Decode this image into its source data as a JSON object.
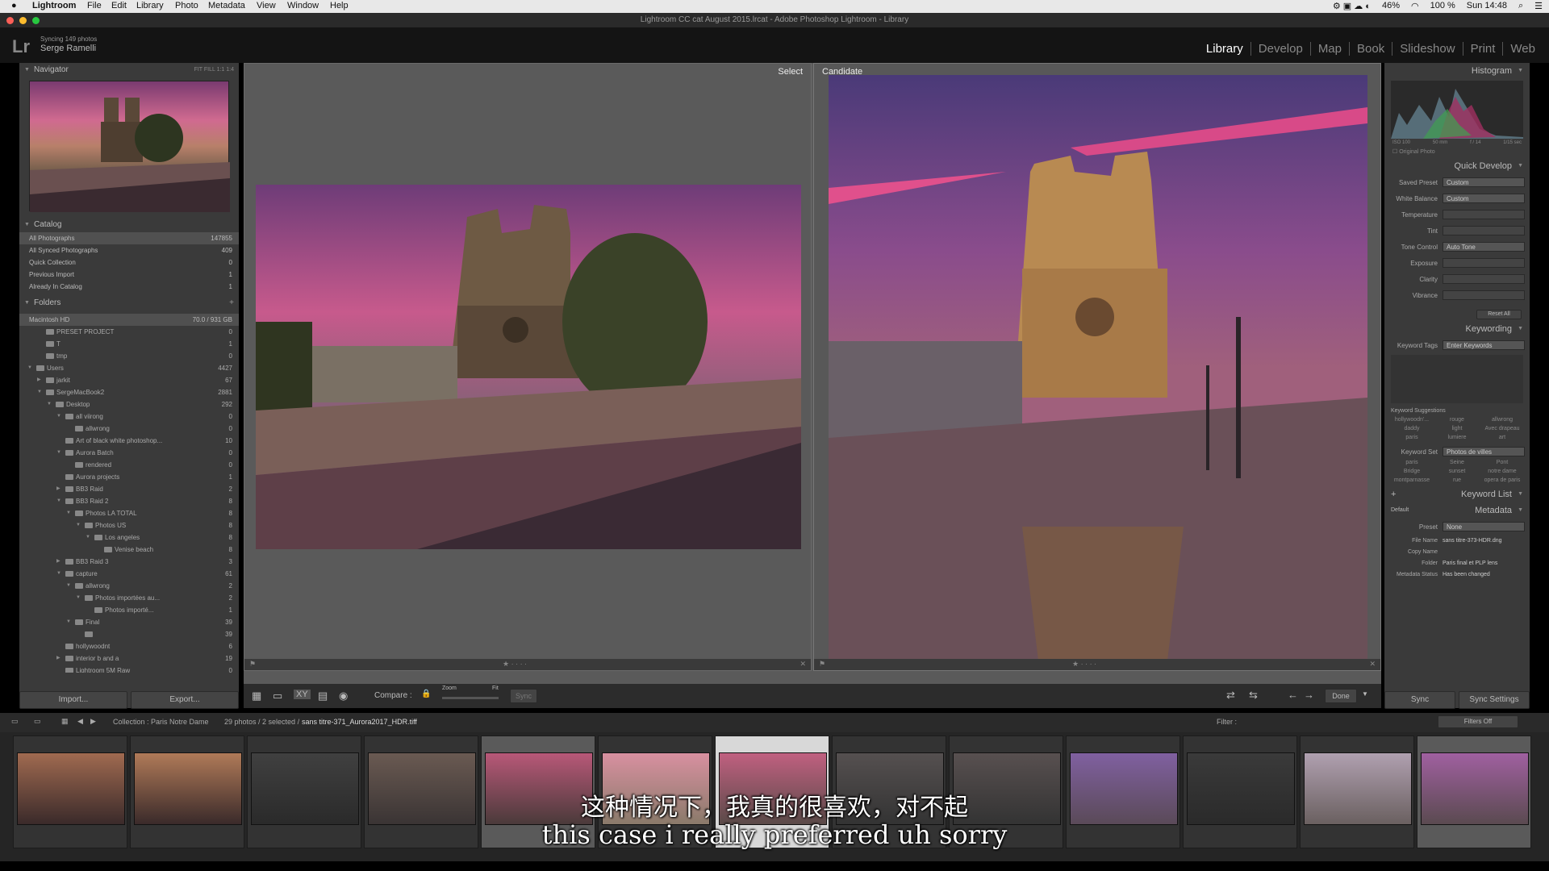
{
  "menubar": {
    "items": [
      "Lightroom",
      "File",
      "Edit",
      "Library",
      "Photo",
      "Metadata",
      "View",
      "Window",
      "Help"
    ],
    "battery": "46%",
    "zoom": "100 %",
    "clock": "Sun 14:48"
  },
  "window": {
    "title": "Lightroom CC cat August 2015.lrcat - Adobe Photoshop Lightroom - Library"
  },
  "identity": {
    "logo": "Lr",
    "sync": "Syncing 149 photos",
    "user": "Serge Ramelli"
  },
  "modules": [
    "Library",
    "Develop",
    "Map",
    "Book",
    "Slideshow",
    "Print",
    "Web"
  ],
  "left": {
    "navigator": {
      "title": "Navigator",
      "opts": "FIT FILL 1:1 1:4"
    },
    "catalog": {
      "title": "Catalog",
      "rows": [
        {
          "label": "All Photographs",
          "count": "147855"
        },
        {
          "label": "All Synced Photographs",
          "count": "409"
        },
        {
          "label": "Quick Collection",
          "count": "0"
        },
        {
          "label": "Previous Import",
          "count": "1"
        },
        {
          "label": "Already In Catalog",
          "count": "1"
        }
      ]
    },
    "folders": {
      "title": "Folders",
      "volume": "Macintosh HD",
      "volume_size": "70.0 / 931 GB",
      "rows": [
        {
          "label": "PRESET PROJECT",
          "count": "0",
          "d": 1,
          "t": ""
        },
        {
          "label": "T",
          "count": "1",
          "d": 1,
          "t": ""
        },
        {
          "label": "tmp",
          "count": "0",
          "d": 1,
          "t": ""
        },
        {
          "label": "Users",
          "count": "4427",
          "d": 0,
          "t": "▼"
        },
        {
          "label": "jarkit",
          "count": "67",
          "d": 1,
          "t": "▶"
        },
        {
          "label": "SergeMacBook2",
          "count": "2881",
          "d": 1,
          "t": "▼"
        },
        {
          "label": "Desktop",
          "count": "292",
          "d": 2,
          "t": "▼"
        },
        {
          "label": "all viirong",
          "count": "0",
          "d": 3,
          "t": "▼"
        },
        {
          "label": "allwrong",
          "count": "0",
          "d": 4,
          "t": ""
        },
        {
          "label": "Art of black white photoshop...",
          "count": "10",
          "d": 3,
          "t": ""
        },
        {
          "label": "Aurora Batch",
          "count": "0",
          "d": 3,
          "t": "▼"
        },
        {
          "label": "rendered",
          "count": "0",
          "d": 4,
          "t": ""
        },
        {
          "label": "Aurora projects",
          "count": "1",
          "d": 3,
          "t": ""
        },
        {
          "label": "BB3 Raid",
          "count": "2",
          "d": 3,
          "t": "▶"
        },
        {
          "label": "BB3 Raid 2",
          "count": "8",
          "d": 3,
          "t": "▼"
        },
        {
          "label": "Photos LA TOTAL",
          "count": "8",
          "d": 4,
          "t": "▼"
        },
        {
          "label": "Photos US",
          "count": "8",
          "d": 5,
          "t": "▼"
        },
        {
          "label": "Los angeles",
          "count": "8",
          "d": 6,
          "t": "▼"
        },
        {
          "label": "Venise beach",
          "count": "8",
          "d": 7,
          "t": ""
        },
        {
          "label": "BB3 Raid 3",
          "count": "3",
          "d": 3,
          "t": "▶"
        },
        {
          "label": "capture",
          "count": "61",
          "d": 3,
          "t": "▼"
        },
        {
          "label": "allwrong",
          "count": "2",
          "d": 4,
          "t": "▼"
        },
        {
          "label": "Photos importées au...",
          "count": "2",
          "d": 5,
          "t": "▼"
        },
        {
          "label": "Photos importé...",
          "count": "1",
          "d": 6,
          "t": ""
        },
        {
          "label": "Final",
          "count": "39",
          "d": 4,
          "t": "▼"
        },
        {
          "label": "",
          "count": "39",
          "d": 5,
          "t": ""
        },
        {
          "label": "hollywoodnt",
          "count": "6",
          "d": 3,
          "t": ""
        },
        {
          "label": "interior b and a",
          "count": "19",
          "d": 3,
          "t": "▶"
        },
        {
          "label": "Lightroom 5M Raw",
          "count": "0",
          "d": 3,
          "t": ""
        }
      ]
    },
    "import_label": "Import...",
    "export_label": "Export..."
  },
  "compare": {
    "select_label": "Select",
    "candidate_label": "Candidate"
  },
  "toolbar": {
    "compare_label": "Compare :",
    "zoom_label": "Zoom",
    "fit_label": "Fit",
    "sync_label": "Sync",
    "done_label": "Done"
  },
  "right": {
    "histogram": {
      "title": "Histogram",
      "iso": "ISO 100",
      "focal": "50 mm",
      "aperture": "f / 14",
      "shutter": "1/15 sec",
      "original": "Original Photo"
    },
    "quick": {
      "title": "Quick Develop",
      "saved_preset": "Saved Preset",
      "preset_val": "Custom",
      "wb": "White Balance",
      "wb_val": "Custom",
      "temp": "Temperature",
      "tint": "Tint",
      "tone": "Tone Control",
      "auto": "Auto Tone",
      "exposure": "Exposure",
      "clarity": "Clarity",
      "vibrance": "Vibrance",
      "reset": "Reset All"
    },
    "keywording": {
      "title": "Keywording",
      "tags_label": "Keyword Tags",
      "tags_val": "Enter Keywords",
      "sugg_title": "Keyword Suggestions",
      "sugg": [
        "hollywoodn'...",
        "rouge",
        "allwrong",
        "daddy",
        "light",
        "Avec drapeau",
        "paris",
        "lumiere",
        "art"
      ],
      "set_label": "Keyword Set",
      "set_val": "Photos de villes",
      "set": [
        "paris",
        "Seine",
        "Pont",
        "Bridge",
        "sunset",
        "notre dame",
        "montparnasse",
        "rue",
        "opera de paris"
      ]
    },
    "keyword_list": "Keyword List",
    "metadata": {
      "title": "Metadata",
      "default": "Default",
      "preset_label": "Preset",
      "preset_val": "None",
      "rows": [
        {
          "k": "File Name",
          "v": "sans titre-373-HDR.dng"
        },
        {
          "k": "Copy Name",
          "v": ""
        },
        {
          "k": "Folder",
          "v": "Paris final et PLP lens"
        },
        {
          "k": "Metadata Status",
          "v": "Has been changed"
        }
      ]
    },
    "sync_label": "Sync",
    "sync_settings_label": "Sync Settings"
  },
  "filmbar": {
    "collection": "Collection : Paris Notre Dame",
    "count": "29 photos / 2 selected /",
    "file": "sans titre-371_Aurora2017_HDR.tiff",
    "filter_label": "Filter :",
    "filters_off": "Filters Off"
  },
  "subtitles": {
    "zh": "这种情况下，我真的很喜欢，对不起",
    "en": "this case i really preferred uh sorry"
  }
}
